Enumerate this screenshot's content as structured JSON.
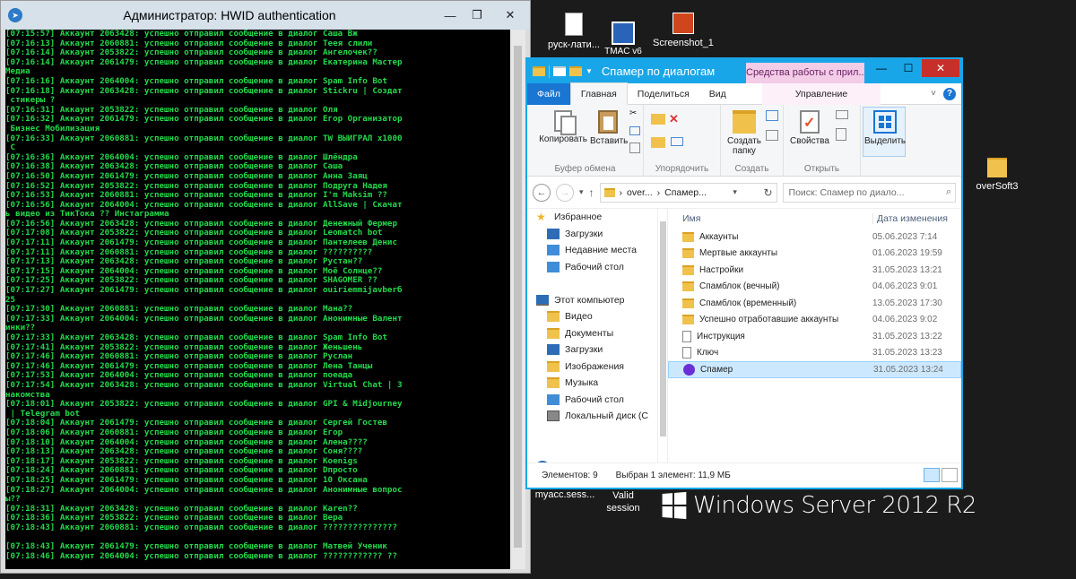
{
  "desktop": {
    "icons": [
      {
        "label": "руск-лати..."
      },
      {
        "label": "TMAC v6"
      },
      {
        "label": "Screenshot_1"
      },
      {
        "label": "overSoft3"
      },
      {
        "label": "myacc.sess..."
      },
      {
        "label": "Valid session"
      }
    ],
    "os_brand": "Windows Server 2012 R2"
  },
  "console": {
    "title": "Администратор:  HWID authentication",
    "lines": [
      "[07:15:57] Аккаунт 2063428: успешно отправил сообщение в диалог Саша Вж",
      "[07:16:13] Аккаунт 2060881: успешно отправил сообщение в диалог Теея слили",
      "[07:16:14] Аккаунт 2053822: успешно отправил сообщение в диалог Ангелочек??",
      "[07:16:14] Аккаунт 2061479: успешно отправил сообщение в диалог Екатерина Мастер",
      "Медиа",
      "[07:16:16] Аккаунт 2064004: успешно отправил сообщение в диалог Spam Info Bot",
      "[07:16:18] Аккаунт 2063428: успешно отправил сообщение в диалог Stickru | Создат",
      " стикеры ?",
      "[07:16:31] Аккаунт 2053822: успешно отправил сообщение в диалог Оля",
      "[07:16:32] Аккаунт 2061479: успешно отправил сообщение в диалог Егор Организатор",
      " Бизнес Мобилизация",
      "[07:16:33] Аккаунт 2060881: успешно отправил сообщение в диалог TW ВЫИГРАЛ x1000",
      " С",
      "[07:16:36] Аккаунт 2064004: успешно отправил сообщение в диалог Шлёндра",
      "[07:16:38] Аккаунт 2063428: успешно отправил сообщение в диалог Саша",
      "[07:16:50] Аккаунт 2061479: успешно отправил сообщение в диалог Анна Заяц",
      "[07:16:52] Аккаунт 2053822: успешно отправил сообщение в диалог Подруга Надея",
      "[07:16:53] Аккаунт 2060881: успешно отправил сообщение в диалог I'm Maksim ??",
      "[07:16:56] Аккаунт 2064004: успешно отправил сообщение в диалог AllSave | Скачат",
      "ь видео из ТикТока ?? Инстаграмма",
      "[07:16:56] Аккаунт 2063428: успешно отправил сообщение в диалог Денежный Фермер",
      "[07:17:08] Аккаунт 2053822: успешно отправил сообщение в диалог Leomatch bot",
      "[07:17:11] Аккаунт 2061479: успешно отправил сообщение в диалог Пантелеев Денис",
      "[07:17:11] Аккаунт 2060881: успешно отправил сообщение в диалог ??????????",
      "[07:17:13] Аккаунт 2063428: успешно отправил сообщение в диалог Рустан??",
      "[07:17:15] Аккаунт 2064004: успешно отправил сообщение в диалог Моё Солнце??",
      "[07:17:25] Аккаунт 2053822: успешно отправил сообщение в диалог SHAGOMER ??",
      "[07:17:27] Аккаунт 2061479: успешно отправил сообщение в диалог ouiriemmijavberб",
      "25",
      "[07:17:30] Аккаунт 2060881: успешно отправил сообщение в диалог Мана??",
      "[07:17:33] Аккаунт 2064004: успешно отправил сообщение в диалог Анонимные Валент",
      "инки??",
      "[07:17:33] Аккаунт 2063428: успешно отправил сообщение в диалог Spam Info Bot",
      "[07:17:41] Аккаунт 2053822: успешно отправил сообщение в диалог Женьшень",
      "[07:17:46] Аккаунт 2060881: успешно отправил сообщение в диалог Руслан",
      "[07:17:46] Аккаунт 2061479: успешно отправил сообщение в диалог Лена Танцы",
      "[07:17:53] Аккаунт 2064004: успешно отправил сообщение в диалог поеада",
      "[07:17:54] Аккаунт 2063428: успешно отправил сообщение в диалог Virtual Chat | З",
      "накомства",
      "[07:18:01] Аккаунт 2053822: успешно отправил сообщение в диалог GPI & Midjourney",
      " | Telegram bot",
      "[07:18:04] Аккаунт 2061479: успешно отправил сообщение в диалог Сергей Гостев",
      "[07:18:06] Аккаунт 2060881: успешно отправил сообщение в диалог Егор",
      "[07:18:10] Аккаунт 2064004: успешно отправил сообщение в диалог Алена????",
      "[07:18:13] Аккаунт 2063428: успешно отправил сообщение в диалог Соня????",
      "[07:18:17] Аккаунт 2053822: успешно отправил сообщение в диалог Koenigs",
      "[07:18:24] Аккаунт 2060881: успешно отправил сообщение в диалог Dпросто",
      "[07:18:25] Аккаунт 2061479: успешно отправил сообщение в диалог 10 Оксана",
      "[07:18:27] Аккаунт 2064004: успешно отправил сообщение в диалог Анонимные вопрос",
      "ы??",
      "[07:18:31] Аккаунт 2063428: успешно отправил сообщение в диалог Karen??",
      "[07:18:36] Аккаунт 2053822: успешно отправил сообщение в диалог Вера",
      "[07:18:43] Аккаунт 2060881: успешно отправил сообщение в диалог ???????????????",
      "",
      "[07:18:43] Аккаунт 2061479: успешно отправил сообщение в диалог Матвей Ученик",
      "[07:18:46] Аккаунт 2064004: успешно отправил сообщение в диалог ???????????? ??"
    ]
  },
  "explorer": {
    "title": "Спамер по диалогам",
    "context_tab": "Средства работы с прил...",
    "tabs": {
      "file": "Файл",
      "home": "Главная",
      "share": "Поделиться",
      "view": "Вид",
      "manage": "Управление"
    },
    "ribbon": {
      "copy": "Копировать",
      "paste": "Вставить",
      "new_folder_1": "Создать",
      "new_folder_2": "папку",
      "properties": "Свойства",
      "select": "Выделить",
      "group_clipboard": "Буфер обмена",
      "group_organize": "Упорядочить",
      "group_new": "Создать",
      "group_open": "Открыть"
    },
    "address": {
      "part1": "over...",
      "part2": "Спамер...",
      "search_placeholder": "Поиск: Спамер по диало..."
    },
    "nav": [
      {
        "label": "Избранное",
        "icon": "star-icon",
        "cls": "i-star",
        "head": true
      },
      {
        "label": "Загрузки",
        "icon": "downloads-icon",
        "cls": "i-dl"
      },
      {
        "label": "Недавние места",
        "icon": "recent-places-icon",
        "cls": "i-blue"
      },
      {
        "label": "Рабочий стол",
        "icon": "desktop-icon",
        "cls": "i-blue"
      },
      {
        "label": "",
        "spacer": true
      },
      {
        "label": "Этот компьютер",
        "icon": "computer-icon",
        "cls": "i-pc",
        "head": true
      },
      {
        "label": "Видео",
        "icon": "video-folder-icon",
        "cls": "i-folder"
      },
      {
        "label": "Документы",
        "icon": "documents-folder-icon",
        "cls": "i-folder"
      },
      {
        "label": "Загрузки",
        "icon": "downloads-icon",
        "cls": "i-dl"
      },
      {
        "label": "Изображения",
        "icon": "pictures-folder-icon",
        "cls": "i-folder"
      },
      {
        "label": "Музыка",
        "icon": "music-folder-icon",
        "cls": "i-folder"
      },
      {
        "label": "Рабочий стол",
        "icon": "desktop-icon",
        "cls": "i-blue"
      },
      {
        "label": "Локальный диск (C",
        "icon": "drive-icon",
        "cls": "i-drive"
      },
      {
        "label": "",
        "spacer": true
      },
      {
        "label": "",
        "spacer": true
      },
      {
        "label": "Сеть",
        "icon": "network-icon",
        "cls": "i-net",
        "head": true
      }
    ],
    "columns": {
      "name": "Имя",
      "date": "Дата изменения"
    },
    "files": [
      {
        "name": "Аккаунты",
        "date": "05.06.2023 7:14",
        "type": "folder"
      },
      {
        "name": "Мертвые аккаунты",
        "date": "01.06.2023 19:59",
        "type": "folder"
      },
      {
        "name": "Настройки",
        "date": "31.05.2023 13:21",
        "type": "folder"
      },
      {
        "name": "Спамблок (вечный)",
        "date": "04.06.2023 9:01",
        "type": "folder"
      },
      {
        "name": "Спамблок (временный)",
        "date": "13.05.2023 17:30",
        "type": "folder"
      },
      {
        "name": "Успешно отработавшие аккаунты",
        "date": "04.06.2023 9:02",
        "type": "folder"
      },
      {
        "name": "Инструкция",
        "date": "31.05.2023 13:22",
        "type": "file"
      },
      {
        "name": "Ключ",
        "date": "31.05.2023 13:23",
        "type": "file"
      },
      {
        "name": "Спамер",
        "date": "31.05.2023 13:24",
        "type": "app",
        "selected": true
      }
    ],
    "status": {
      "count": "Элементов: 9",
      "selection": "Выбран 1 элемент: 11,9 МБ"
    }
  }
}
